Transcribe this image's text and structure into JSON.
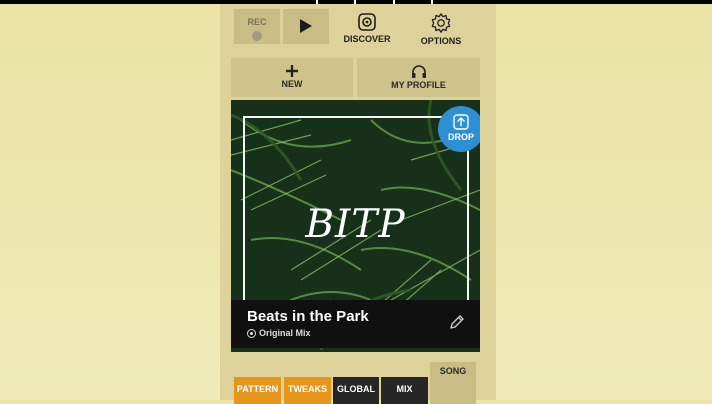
{
  "transport": {
    "rec_label": "REC"
  },
  "topnav": {
    "discover_label": "DISCOVER",
    "options_label": "OPTIONS"
  },
  "actions": {
    "new_label": "NEW",
    "profile_label": "MY PROFILE"
  },
  "card": {
    "art_text": "BITP",
    "drop_label": "DROP",
    "song_title": "Beats in the Park",
    "mix_label": "Original Mix"
  },
  "tabs": {
    "pattern": "PATTERN",
    "tweaks": "TWEAKS",
    "global": "GLOBAL",
    "mix": "MIX",
    "song": "SONG"
  },
  "colors": {
    "accent_orange": "#e5961b",
    "drop_blue": "#2e8fd5",
    "panel": "#ddd29a"
  }
}
